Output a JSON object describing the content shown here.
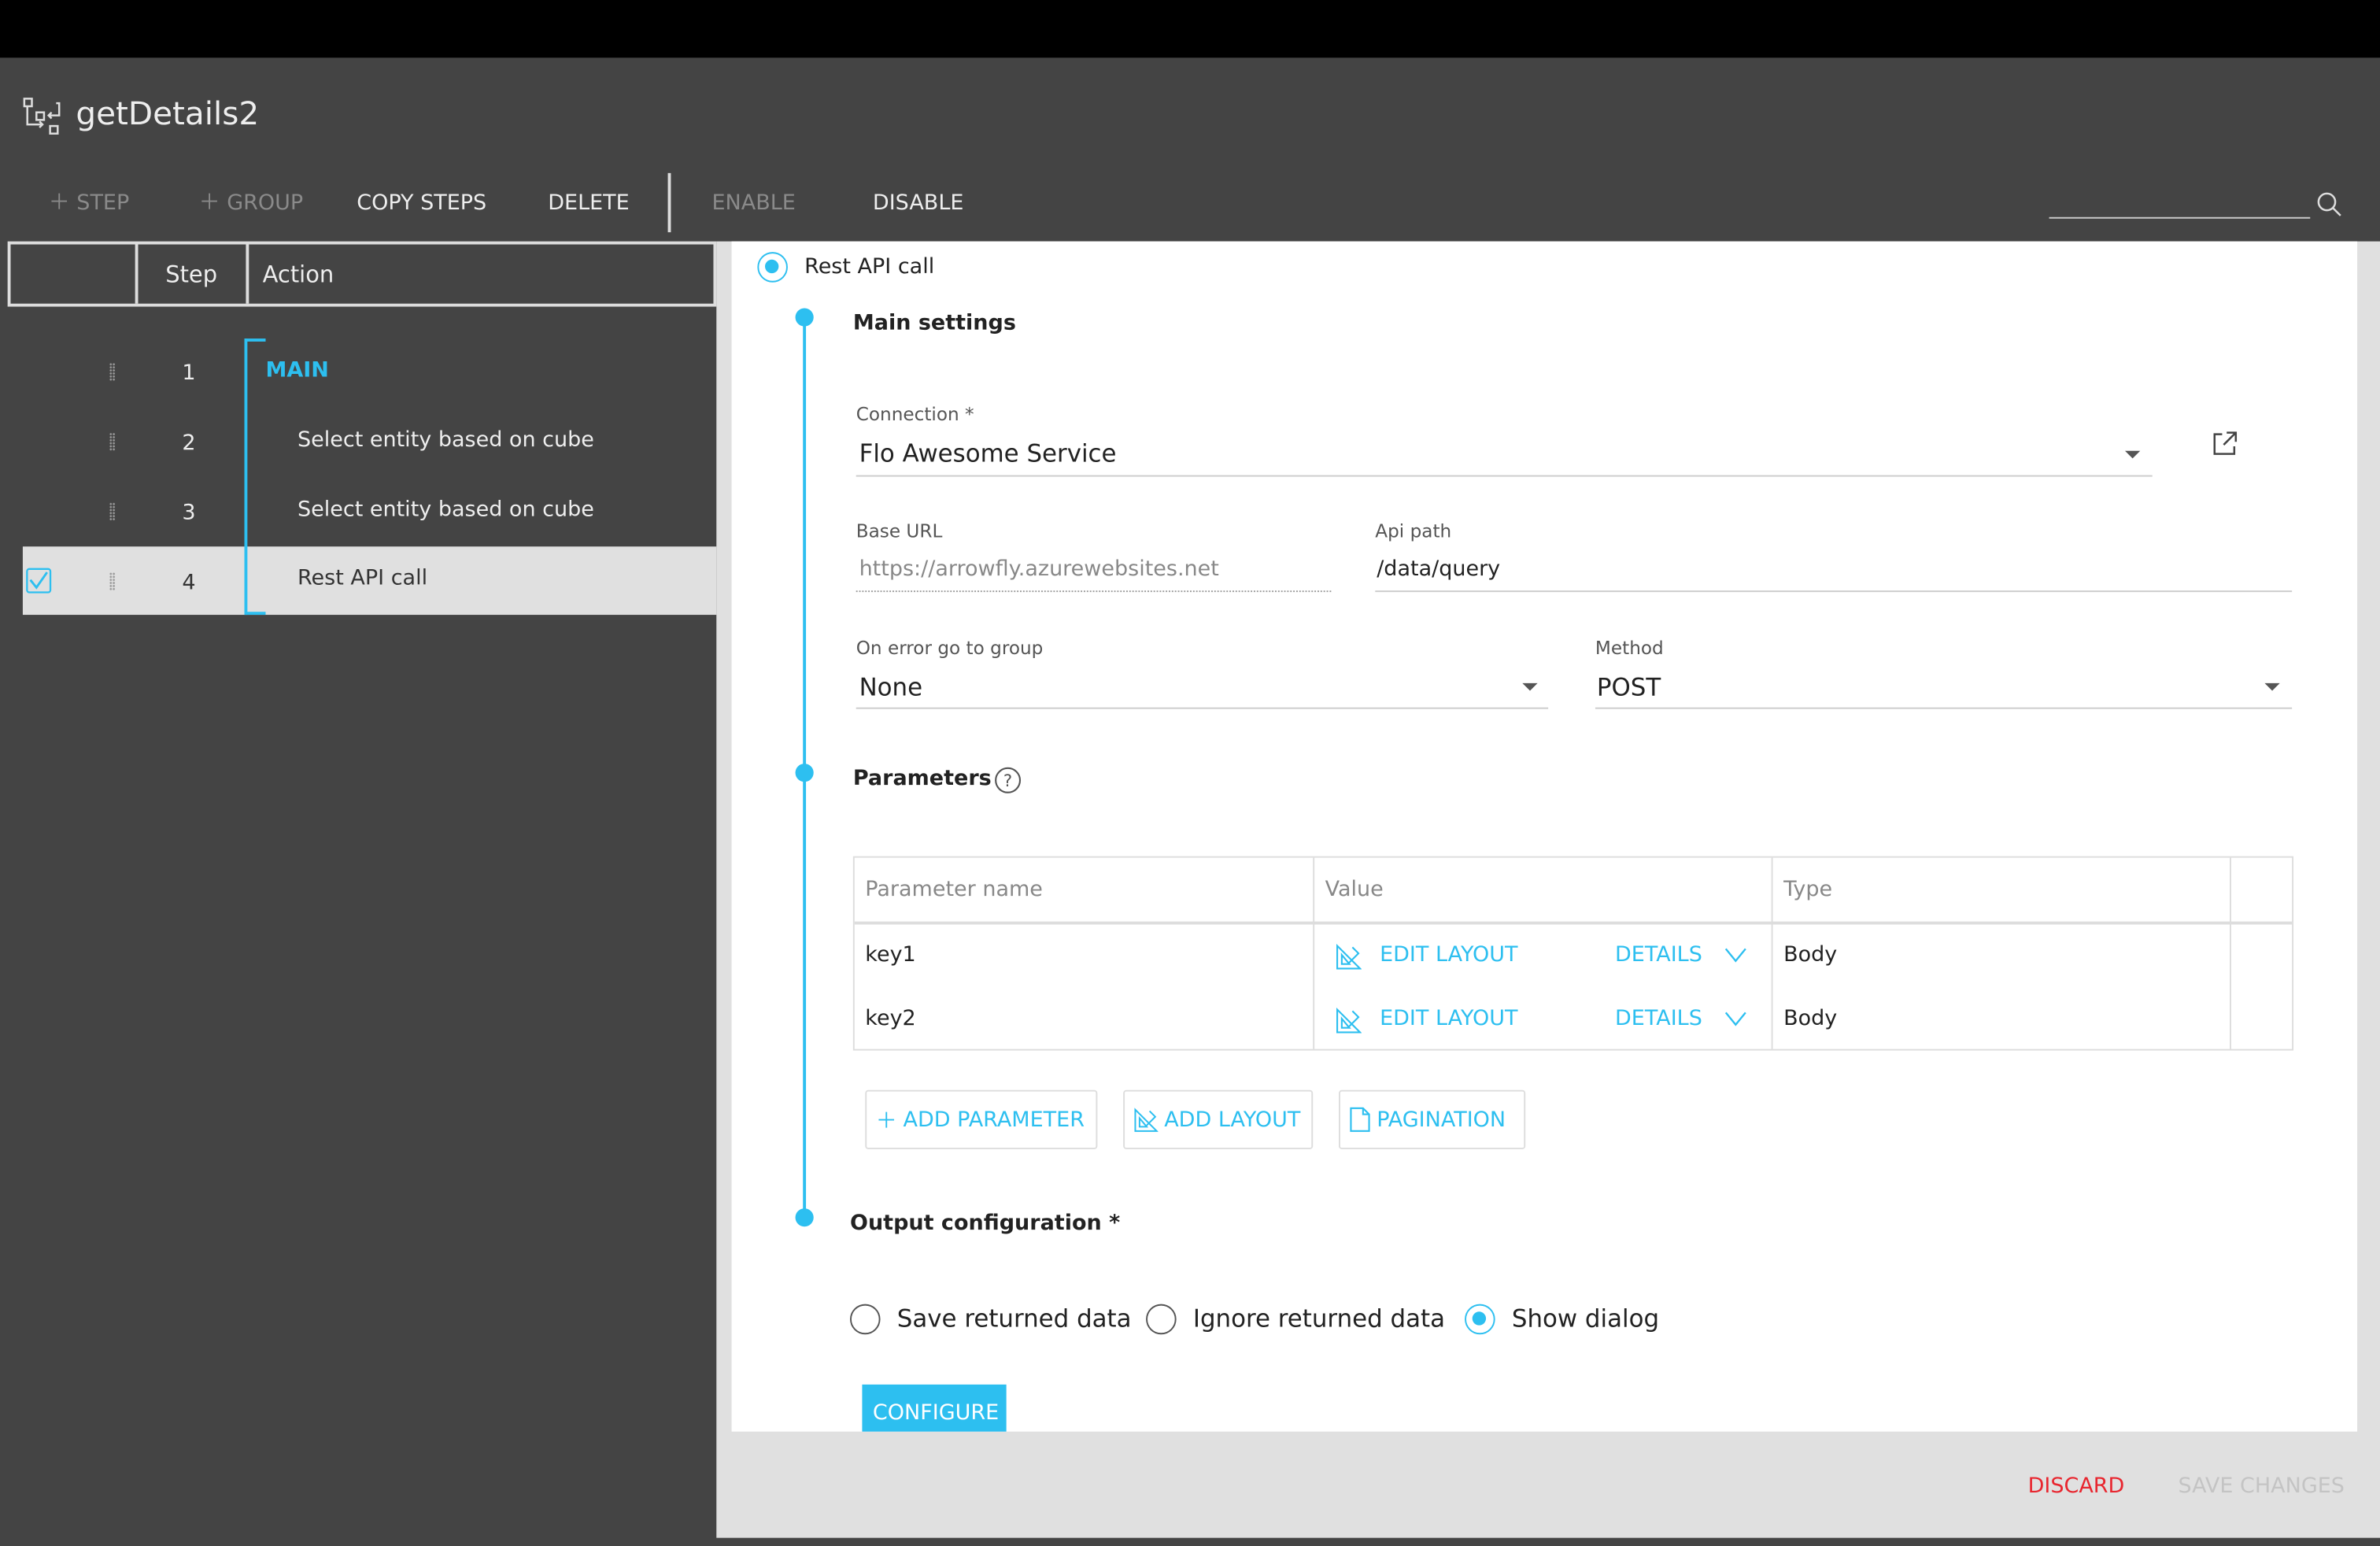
{
  "app": {
    "title": "getDetails2"
  },
  "toolbar": {
    "step": "STEP",
    "group": "GROUP",
    "copy_steps": "COPY STEPS",
    "delete": "DELETE",
    "enable": "ENABLE",
    "disable": "DISABLE",
    "search_placeholder": ""
  },
  "steps_table": {
    "headers": [
      "",
      "Step",
      "Action"
    ],
    "rows": [
      {
        "step": "1",
        "action": "MAIN",
        "checked": false
      },
      {
        "step": "2",
        "action": "Select entity based on cube",
        "checked": false
      },
      {
        "step": "3",
        "action": "Select entity based on cube",
        "checked": false
      },
      {
        "step": "4",
        "action": "Rest API call",
        "checked": true
      }
    ]
  },
  "detail": {
    "step_type": "Rest API call",
    "main_settings": "Main settings",
    "connection": {
      "label": "Connection *",
      "value": "Flo Awesome Service"
    },
    "base_url": {
      "label": "Base URL",
      "value": "https://arrowfly.azurewebsites.net"
    },
    "api_path": {
      "label": "Api path",
      "value": "/data/query"
    },
    "on_error": {
      "label": "On error go to group",
      "value": "None"
    },
    "method": {
      "label": "Method",
      "value": "POST"
    },
    "parameters": {
      "title": "Parameters",
      "headers": [
        "Parameter name",
        "Value",
        "Type"
      ],
      "rows": [
        {
          "name": "key1",
          "edit": "EDIT LAYOUT",
          "details": "DETAILS",
          "type": "Body"
        },
        {
          "name": "key2",
          "edit": "EDIT LAYOUT",
          "details": "DETAILS",
          "type": "Body"
        }
      ],
      "add_parameter": "ADD PARAMETER",
      "add_layout": "ADD LAYOUT",
      "pagination": "PAGINATION"
    },
    "output": {
      "title": "Output configuration *",
      "options": [
        "Save returned data",
        "Ignore returned data",
        "Show dialog"
      ],
      "selected": "Show dialog",
      "configure": "CONFIGURE"
    }
  },
  "footer": {
    "discard": "DISCARD",
    "save": "SAVE CHANGES"
  },
  "colors": {
    "accent": "#2dbff0",
    "danger": "#e8262f",
    "dark_bg": "#444444"
  }
}
